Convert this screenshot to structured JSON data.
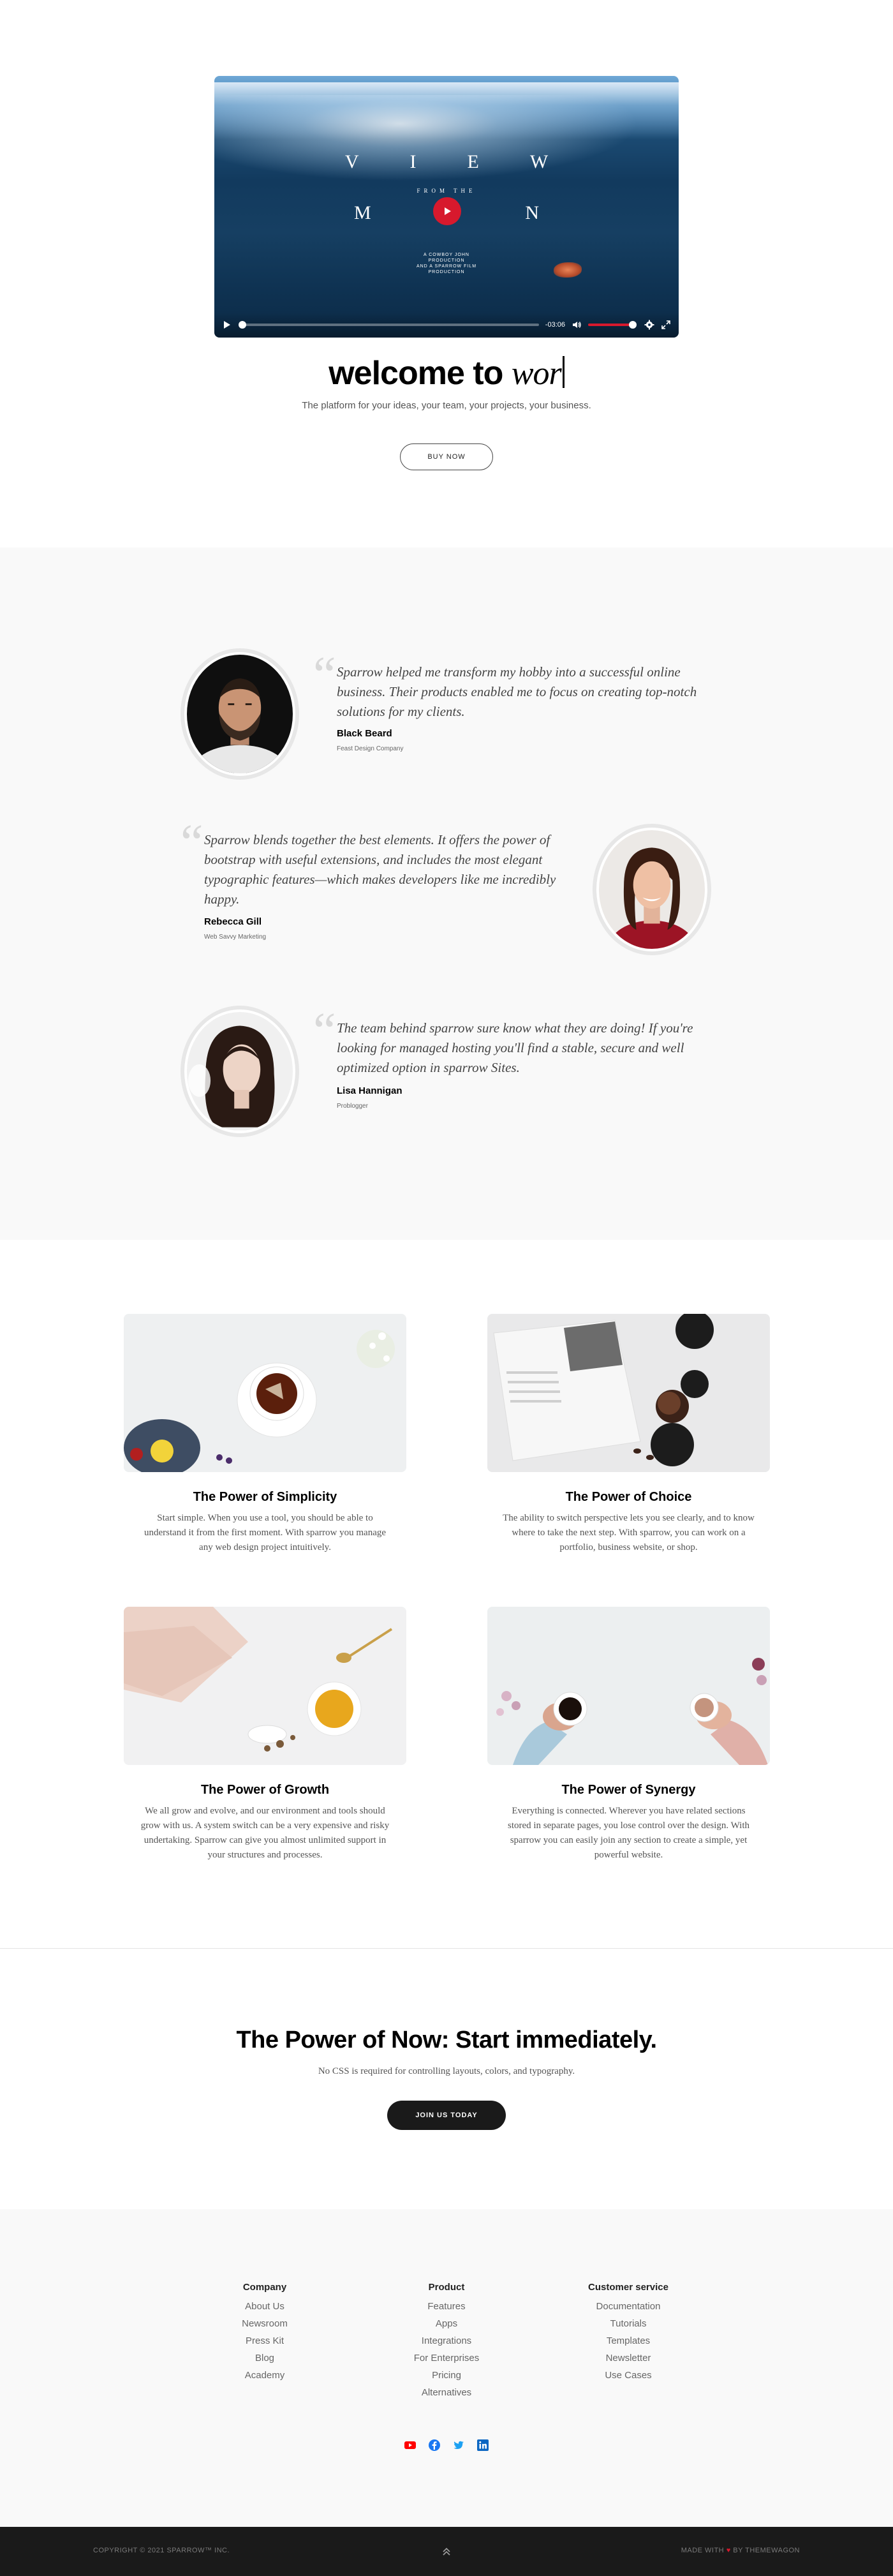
{
  "hero": {
    "video": {
      "title_line1": "VIEW",
      "title_line2": "FROM THE",
      "title_line3": "MON",
      "credits": "A COWBOY JOHN PRODUCTION\nAND A SPARROW FILM PRODUCTION",
      "current_time": "-03:06",
      "progress": 0.0,
      "volume": 1.0,
      "accent_color": "#d7192d"
    },
    "heading_static": "welcome to",
    "heading_typed": "wor",
    "subtitle": "The platform for your ideas, your team, your projects, your business.",
    "button_label": "BUY NOW"
  },
  "testimonials": [
    {
      "quote": "Sparrow helped me transform my hobby into a successful online business. Their products enabled me to focus on creating top-notch solutions for my clients.",
      "name": "Black Beard",
      "role": "Feast Design Company"
    },
    {
      "quote": "Sparrow blends together the best elements. It offers the power of bootstrap with useful extensions, and includes the most elegant typographic features—which makes developers like me incredibly happy.",
      "name": "Rebecca Gill",
      "role": "Web Savvy Marketing"
    },
    {
      "quote": "The team behind sparrow sure know what they are doing! If you're looking for managed hosting you'll find a stable, secure and well optimized option in sparrow Sites.",
      "name": "Lisa Hannigan",
      "role": "Problogger"
    }
  ],
  "features": [
    {
      "title": "The Power of Simplicity",
      "text": "Start simple. When you use a tool, you should be able to understand it from the first moment. With sparrow you manage any web design project intuitively."
    },
    {
      "title": "The Power of Choice",
      "text": "The ability to switch perspective lets you see clearly, and to know where to take the next step. With sparrow, you can work on a portfolio, business website, or shop."
    },
    {
      "title": "The Power of Growth",
      "text": "We all grow and evolve, and our environment and tools should grow with us. A system switch can be a very expensive and risky undertaking. Sparrow can give you almost unlimited support in your structures and processes."
    },
    {
      "title": "The Power of Synergy",
      "text": "Everything is connected. Wherever you have related sections stored in separate pages, you lose control over the design. With sparrow you can easily join any section to create a simple, yet powerful website."
    }
  ],
  "cta": {
    "title": "The Power of Now: Start immediately.",
    "subtitle": "No CSS is required for controlling layouts, colors, and typography.",
    "button_label": "JOIN US TODAY"
  },
  "footer": {
    "columns": [
      {
        "heading": "Company",
        "links": [
          "About Us",
          "Newsroom",
          "Press Kit",
          "Blog",
          "Academy"
        ]
      },
      {
        "heading": "Product",
        "links": [
          "Features",
          "Apps",
          "Integrations",
          "For Enterprises",
          "Pricing",
          "Alternatives"
        ]
      },
      {
        "heading": "Customer service",
        "links": [
          "Documentation",
          "Tutorials",
          "Templates",
          "Newsletter",
          "Use Cases"
        ]
      }
    ],
    "socials": [
      "youtube-icon",
      "facebook-icon",
      "twitter-icon",
      "linkedin-icon"
    ],
    "social_colors": {
      "youtube": "#ff0000",
      "facebook": "#1877f2",
      "twitter": "#1da1f2",
      "linkedin": "#0a66c2"
    },
    "copyright": "COPYRIGHT © 2021 SPARROW™ INC.",
    "made_prefix": "MADE WITH",
    "made_suffix": "BY THEMEWAGON"
  }
}
